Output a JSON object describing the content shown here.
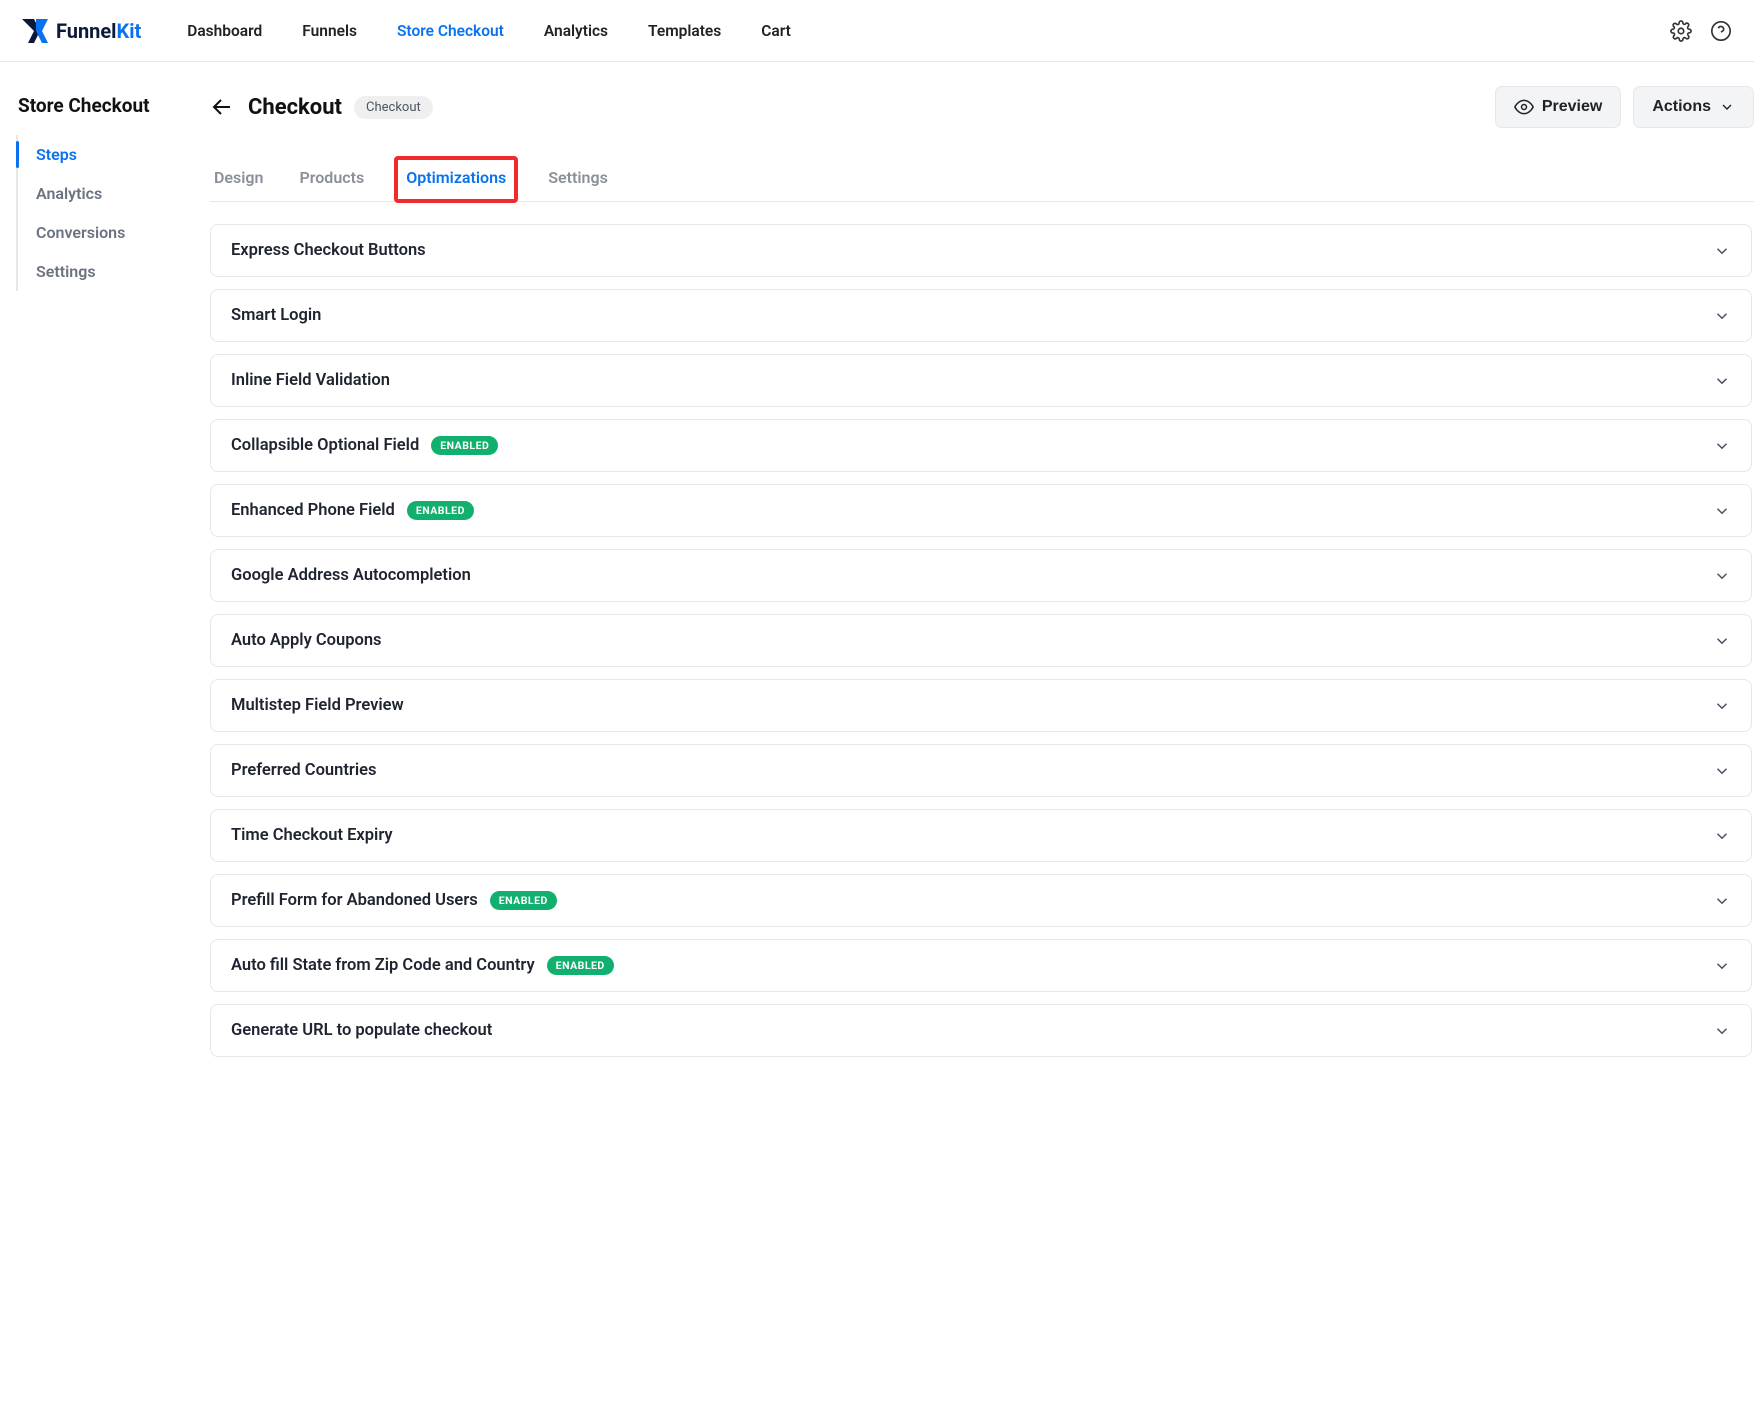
{
  "brand": {
    "funnel": "Funnel",
    "kit": "Kit"
  },
  "topnav": {
    "items": [
      {
        "label": "Dashboard",
        "active": false
      },
      {
        "label": "Funnels",
        "active": false
      },
      {
        "label": "Store Checkout",
        "active": true
      },
      {
        "label": "Analytics",
        "active": false
      },
      {
        "label": "Templates",
        "active": false
      },
      {
        "label": "Cart",
        "active": false
      }
    ]
  },
  "sidebar": {
    "title": "Store Checkout",
    "items": [
      {
        "label": "Steps",
        "active": true
      },
      {
        "label": "Analytics",
        "active": false
      },
      {
        "label": "Conversions",
        "active": false
      },
      {
        "label": "Settings",
        "active": false
      }
    ]
  },
  "header": {
    "title": "Checkout",
    "badge": "Checkout",
    "preview_label": "Preview",
    "actions_label": "Actions"
  },
  "tabs": [
    {
      "label": "Design",
      "active": false,
      "highlight": false
    },
    {
      "label": "Products",
      "active": false,
      "highlight": false
    },
    {
      "label": "Optimizations",
      "active": true,
      "highlight": true
    },
    {
      "label": "Settings",
      "active": false,
      "highlight": false
    }
  ],
  "enabled_label": "ENABLED",
  "accordion": [
    {
      "title": "Express Checkout Buttons",
      "enabled": false
    },
    {
      "title": "Smart Login",
      "enabled": false
    },
    {
      "title": "Inline Field Validation",
      "enabled": false
    },
    {
      "title": "Collapsible Optional Field",
      "enabled": true
    },
    {
      "title": "Enhanced Phone Field",
      "enabled": true
    },
    {
      "title": "Google Address Autocompletion",
      "enabled": false
    },
    {
      "title": "Auto Apply Coupons",
      "enabled": false
    },
    {
      "title": "Multistep Field Preview",
      "enabled": false
    },
    {
      "title": "Preferred Countries",
      "enabled": false
    },
    {
      "title": "Time Checkout Expiry",
      "enabled": false
    },
    {
      "title": "Prefill Form for Abandoned Users",
      "enabled": true
    },
    {
      "title": "Auto fill State from Zip Code and Country",
      "enabled": true
    },
    {
      "title": "Generate URL to populate checkout",
      "enabled": false
    }
  ]
}
